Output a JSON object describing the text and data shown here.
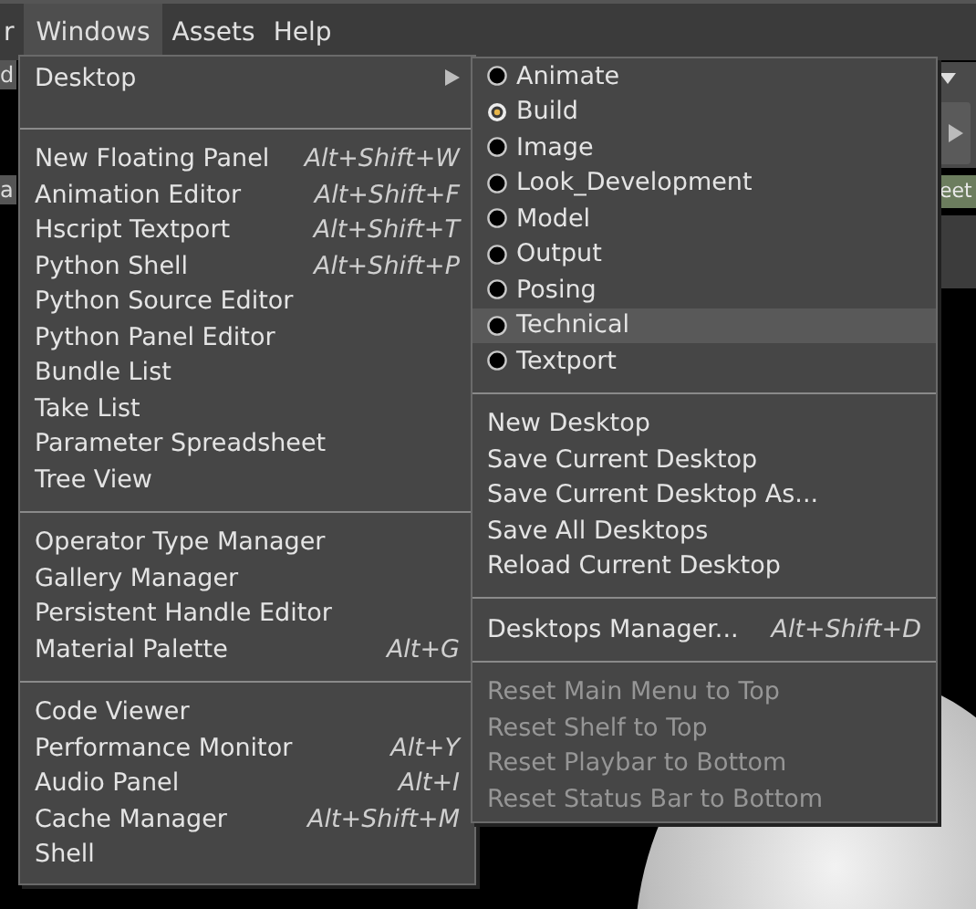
{
  "menubar": {
    "items": [
      {
        "label": "r",
        "selected": false
      },
      {
        "label": "Windows",
        "selected": true
      },
      {
        "label": "Assets",
        "selected": false
      },
      {
        "label": "Help",
        "selected": false
      }
    ]
  },
  "background": {
    "left_fragments": [
      "d",
      "a"
    ],
    "right_tab": "eet"
  },
  "windows_menu": {
    "sections": [
      [
        {
          "label": "Desktop",
          "submenu": true
        }
      ],
      [
        {
          "label": "New Floating Panel",
          "shortcut": "Alt+Shift+W"
        },
        {
          "label": "Animation Editor",
          "shortcut": "Alt+Shift+F"
        },
        {
          "label": "Hscript Textport",
          "shortcut": "Alt+Shift+T"
        },
        {
          "label": "Python Shell",
          "shortcut": "Alt+Shift+P"
        },
        {
          "label": "Python Source Editor"
        },
        {
          "label": "Python Panel Editor"
        },
        {
          "label": "Bundle List"
        },
        {
          "label": "Take List"
        },
        {
          "label": "Parameter Spreadsheet"
        },
        {
          "label": "Tree View"
        }
      ],
      [
        {
          "label": "Operator Type Manager"
        },
        {
          "label": "Gallery Manager"
        },
        {
          "label": "Persistent Handle Editor"
        },
        {
          "label": "Material Palette",
          "shortcut": "Alt+G"
        }
      ],
      [
        {
          "label": "Code Viewer"
        },
        {
          "label": "Performance Monitor",
          "shortcut": "Alt+Y"
        },
        {
          "label": "Audio Panel",
          "shortcut": "Alt+I"
        },
        {
          "label": "Cache Manager",
          "shortcut": "Alt+Shift+M"
        },
        {
          "label": "Shell"
        }
      ]
    ]
  },
  "desktop_submenu": {
    "sections": [
      [
        {
          "kind": "radio",
          "label": "Animate",
          "selected": false,
          "highlighted": false
        },
        {
          "kind": "radio",
          "label": "Build",
          "selected": true,
          "highlighted": false
        },
        {
          "kind": "radio",
          "label": "Image",
          "selected": false,
          "highlighted": false
        },
        {
          "kind": "radio",
          "label": "Look_Development",
          "selected": false,
          "highlighted": false
        },
        {
          "kind": "radio",
          "label": "Model",
          "selected": false,
          "highlighted": false
        },
        {
          "kind": "radio",
          "label": "Output",
          "selected": false,
          "highlighted": false
        },
        {
          "kind": "radio",
          "label": "Posing",
          "selected": false,
          "highlighted": false
        },
        {
          "kind": "radio",
          "label": "Technical",
          "selected": false,
          "highlighted": true
        },
        {
          "kind": "radio",
          "label": "Textport",
          "selected": false,
          "highlighted": false
        }
      ],
      [
        {
          "kind": "action",
          "label": "New Desktop",
          "disabled": false
        },
        {
          "kind": "action",
          "label": "Save Current Desktop",
          "disabled": false
        },
        {
          "kind": "action",
          "label": "Save Current Desktop As...",
          "disabled": false
        },
        {
          "kind": "action",
          "label": "Save All Desktops",
          "disabled": false
        },
        {
          "kind": "action",
          "label": "Reload Current Desktop",
          "disabled": false
        }
      ],
      [
        {
          "kind": "action",
          "label": "Desktops Manager...",
          "shortcut": "Alt+Shift+D",
          "disabled": false
        }
      ],
      [
        {
          "kind": "action",
          "label": "Reset Main Menu to Top",
          "disabled": true
        },
        {
          "kind": "action",
          "label": "Reset Shelf to Top",
          "disabled": true
        },
        {
          "kind": "action",
          "label": "Reset Playbar to Bottom",
          "disabled": true
        },
        {
          "kind": "action",
          "label": "Reset Status Bar to Bottom",
          "disabled": true
        }
      ]
    ]
  }
}
